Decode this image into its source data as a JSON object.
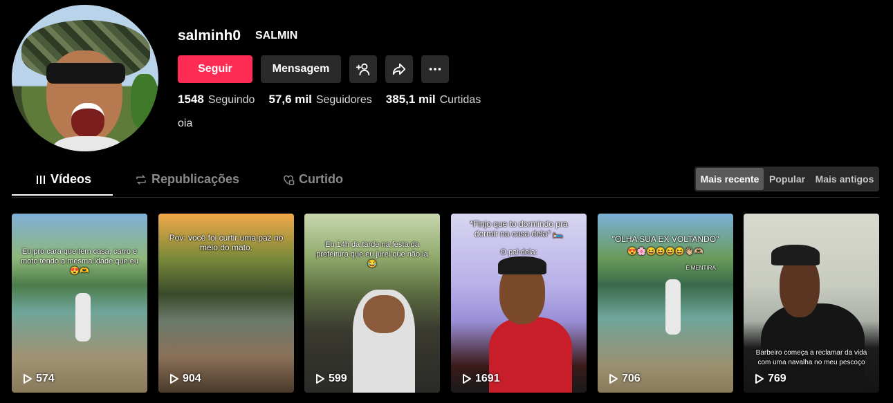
{
  "profile": {
    "username": "salminh0",
    "nickname": "SALMIN",
    "bio": "oia"
  },
  "actions": {
    "follow_label": "Seguir",
    "message_label": "Mensagem"
  },
  "stats": {
    "following_count": "1548",
    "following_label": "Seguindo",
    "followers_count": "57,6 mil",
    "followers_label": "Seguidores",
    "likes_count": "385,1 mil",
    "likes_label": "Curtidas"
  },
  "tabs": [
    {
      "label": "Vídeos",
      "icon": "grid-icon",
      "active": true
    },
    {
      "label": "Republicações",
      "icon": "repost-icon"
    },
    {
      "label": "Curtido",
      "icon": "heart-lock-icon"
    }
  ],
  "sort": {
    "options": [
      "Mais recente",
      "Popular",
      "Mais antigos"
    ],
    "selected": "Mais recente"
  },
  "videos": [
    {
      "caption": "Eu pro cara que tem casa, carro e moto tendo a mesma idade que eu 😍🫶",
      "views": "574"
    },
    {
      "caption": "Pov: você foi curtir uma paz no meio do mato.",
      "views": "904"
    },
    {
      "caption": "Eu 14h da tarde na festa da prefeitura que eu jurei que não ia 😂",
      "views": "599"
    },
    {
      "caption": "*Finjo que to dormindo pra dormir na casa dela* 🛏️",
      "caption2": "O pai dela:",
      "views": "1691"
    },
    {
      "caption": "\"OLHA SUA EX VOLTANDO\"",
      "caption2": "😍🌸😆😆😆😆👋🏼🫶🏼",
      "caption3": "É MENTIRA",
      "views": "706"
    },
    {
      "caption": "Barbeiro começa a reclamar da vida com uma navalha no meu pescoço",
      "views": "769"
    }
  ]
}
